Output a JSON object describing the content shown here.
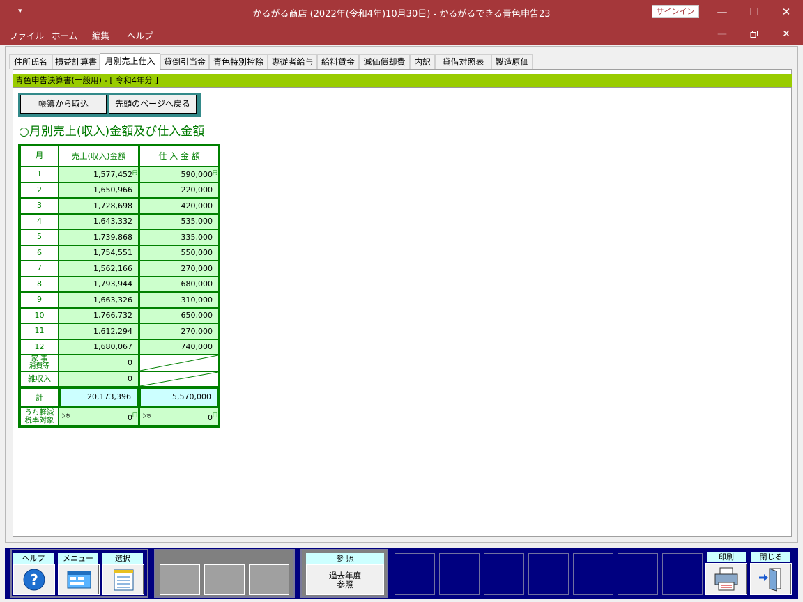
{
  "window": {
    "title": "かるがる商店 (2022年(令和4年)10月30日)  -  かるがるできる青色申告23",
    "signin": "サインイン",
    "min": "—",
    "max": "☐",
    "close": "✕",
    "sysmenu": "▾"
  },
  "menu": [
    "ファイル",
    "ホーム",
    "編集",
    "ヘルプ"
  ],
  "tabs": [
    "住所氏名",
    "損益計算書",
    "月別売上仕入",
    "貸倒引当金",
    "青色特別控除",
    "専従者給与",
    "給料賃金",
    "減価償却費",
    "内訳",
    "貸借対照表",
    "製造原価"
  ],
  "active_tab": "月別売上仕入",
  "form_title": "青色申告決算書(一般用) - [ 令和4年分 ]",
  "buttons": {
    "import": "帳簿から取込",
    "first_page": "先頭のページへ戻る"
  },
  "heading": "○月別売上(収入)金額及び仕入金額",
  "table": {
    "col_month": "月",
    "col_sales": "売上(収入)金額",
    "col_purchase": "仕 入 金 額",
    "yen": "円",
    "rows": [
      {
        "m": "1",
        "sales": "1,577,452",
        "purchase": "590,000"
      },
      {
        "m": "2",
        "sales": "1,650,966",
        "purchase": "220,000"
      },
      {
        "m": "3",
        "sales": "1,728,698",
        "purchase": "420,000"
      },
      {
        "m": "4",
        "sales": "1,643,332",
        "purchase": "535,000"
      },
      {
        "m": "5",
        "sales": "1,739,868",
        "purchase": "335,000"
      },
      {
        "m": "6",
        "sales": "1,754,551",
        "purchase": "550,000"
      },
      {
        "m": "7",
        "sales": "1,562,166",
        "purchase": "270,000"
      },
      {
        "m": "8",
        "sales": "1,793,944",
        "purchase": "680,000"
      },
      {
        "m": "9",
        "sales": "1,663,326",
        "purchase": "310,000"
      },
      {
        "m": "10",
        "sales": "1,766,732",
        "purchase": "650,000"
      },
      {
        "m": "11",
        "sales": "1,612,294",
        "purchase": "270,000"
      },
      {
        "m": "12",
        "sales": "1,680,067",
        "purchase": "740,000"
      }
    ],
    "household_label_1": "家 事",
    "household_label_2": "消費等",
    "household_sales": "0",
    "misc_label": "雑収入",
    "misc_sales": "0",
    "total_label": "計",
    "total_sales": "20,173,396",
    "total_purchase": "5,570,000",
    "reduced_label_1": "うち軽減",
    "reduced_label_2": "税率対象",
    "uchi": "うち",
    "reduced_sales": "0",
    "reduced_purchase": "0"
  },
  "toolbar": {
    "help": "ヘルプ",
    "menu": "メニュー",
    "select": "選択",
    "ref": "参 照",
    "ref_btn_1": "過去年度",
    "ref_btn_2": "参照",
    "print": "印刷",
    "close": "閉じる"
  }
}
